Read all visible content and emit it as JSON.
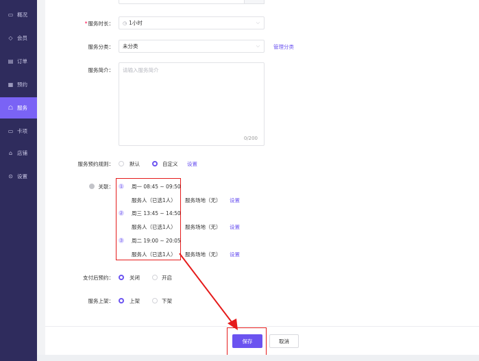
{
  "sidebar": {
    "items": [
      {
        "label": "概况",
        "icon": "overview-icon",
        "glyph": "▭"
      },
      {
        "label": "会员",
        "icon": "member-icon",
        "glyph": "◇"
      },
      {
        "label": "订单",
        "icon": "order-icon",
        "glyph": "▤"
      },
      {
        "label": "预约",
        "icon": "reservation-icon",
        "glyph": "▦"
      },
      {
        "label": "服务",
        "icon": "service-icon",
        "glyph": "☖"
      },
      {
        "label": "卡项",
        "icon": "card-icon",
        "glyph": "▭"
      },
      {
        "label": "店铺",
        "icon": "store-icon",
        "glyph": "⌂"
      },
      {
        "label": "设置",
        "icon": "settings-icon",
        "glyph": "⊙"
      }
    ],
    "active_index": 4
  },
  "form": {
    "duration": {
      "label": "服务时长：",
      "required": "*",
      "value": "1小时",
      "icon": "clock-icon"
    },
    "category": {
      "label": "服务分类：",
      "value": "未分类",
      "manage_link": "管理分类"
    },
    "intro": {
      "label": "服务简介：",
      "placeholder": "请输入服务简介",
      "counter": "0/200"
    },
    "booking_rule": {
      "label": "服务预约规则：",
      "option_default": "默认",
      "option_custom": "自定义",
      "selected": "自定义",
      "set_link": "设置"
    },
    "association": {
      "label": "关联：",
      "items": [
        {
          "index": "1",
          "time": "周一 08:45 ~ 09:50",
          "staff": "服务人（已选1人）",
          "venue": "服务场地（无）",
          "set_link": "设置"
        },
        {
          "index": "2",
          "time": "周三 13:45 ~ 14:50",
          "staff": "服务人（已选1人）",
          "venue": "服务场地（无）",
          "set_link": "设置"
        },
        {
          "index": "3",
          "time": "周二 19:00 ~ 20:05",
          "staff": "服务人（已选1人）",
          "venue": "服务场地（无）",
          "set_link": "设置"
        }
      ]
    },
    "pay_then_book": {
      "label": "支付后预约：",
      "option_off": "关闭",
      "option_on": "开启",
      "selected": "关闭"
    },
    "listing": {
      "label": "服务上架：",
      "option_on": "上架",
      "option_off": "下架",
      "selected": "上架"
    }
  },
  "footer": {
    "save_label": "保存",
    "cancel_label": "取消"
  },
  "colors": {
    "sidebar_bg": "#2f2c5d",
    "accent": "#6b53f0",
    "annotation_red": "#e51a1a"
  }
}
